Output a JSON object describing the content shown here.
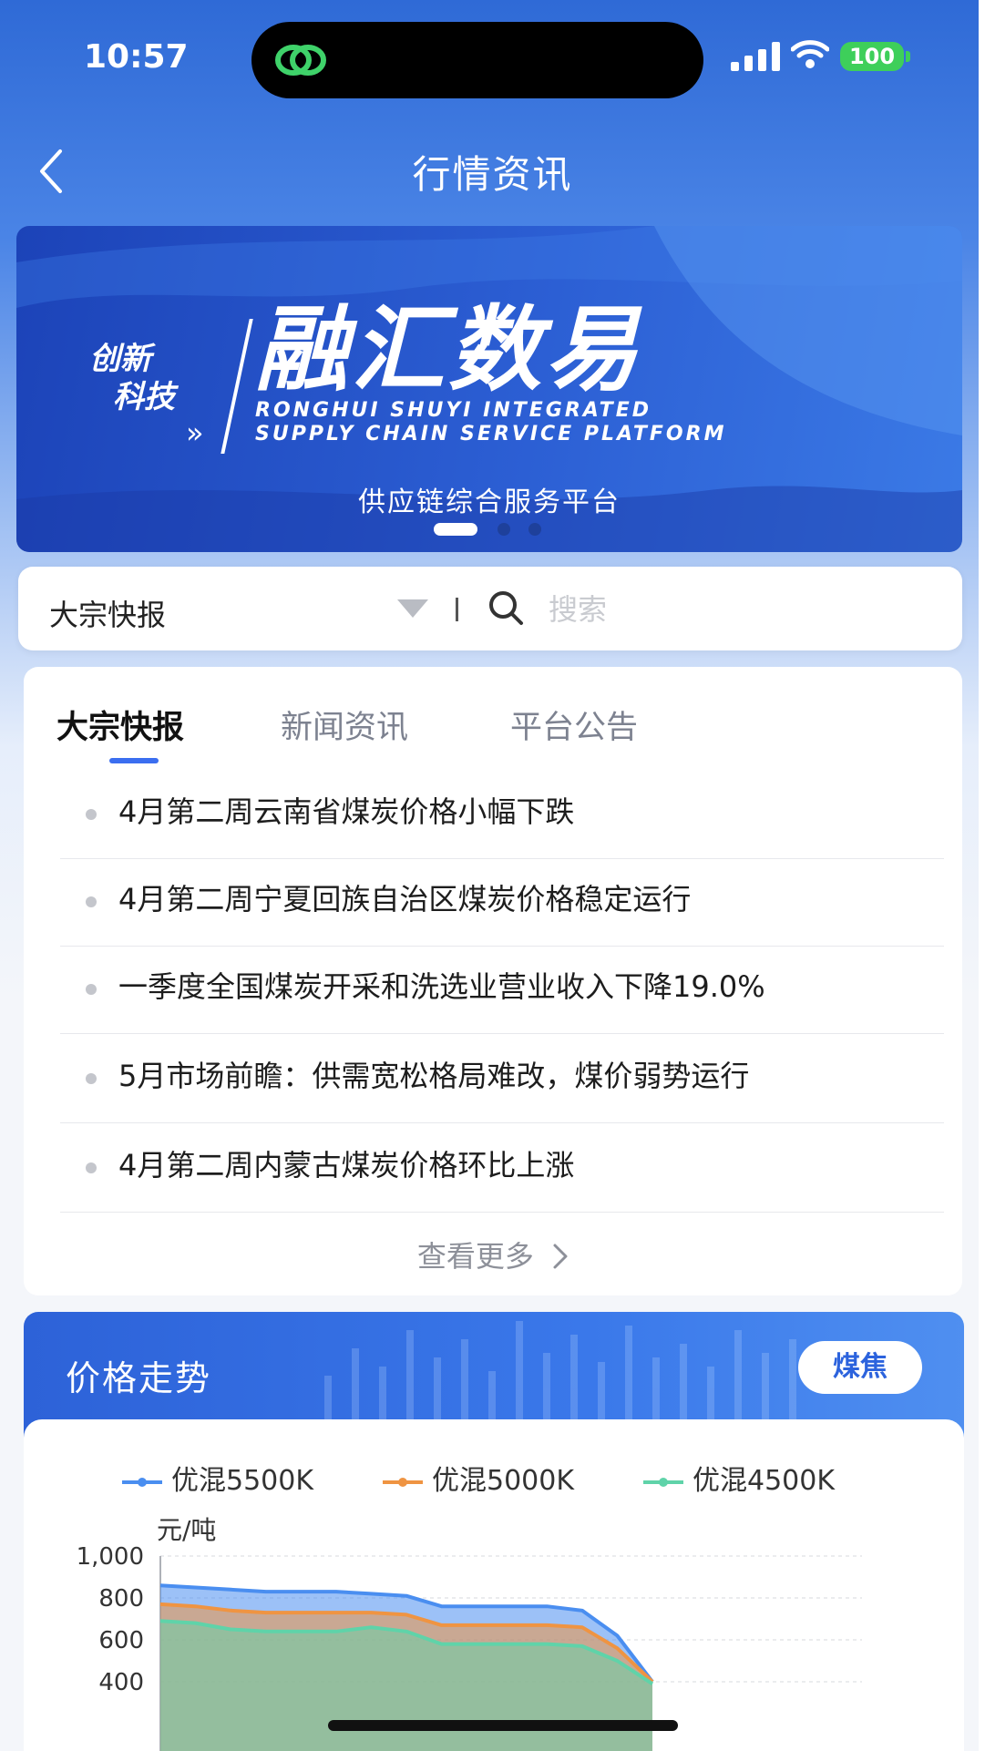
{
  "status_bar": {
    "time": "10:57",
    "battery": "100"
  },
  "header": {
    "title": "行情资讯"
  },
  "banner": {
    "tag_line1": "创新",
    "tag_line2": "科技",
    "tag_arrows": "»",
    "brand": "融汇数易",
    "brand_en_line1": "RONGHUI SHUYI INTEGRATED",
    "brand_en_line2": "SUPPLY CHAIN SERVICE PLATFORM",
    "subtitle": "供应链综合服务平台",
    "active_slide": 1,
    "slide_count": 3
  },
  "search": {
    "category": "大宗快报",
    "separator": "|",
    "placeholder": "搜索"
  },
  "news": {
    "tabs": [
      {
        "label": "大宗快报",
        "active": true
      },
      {
        "label": "新闻资讯",
        "active": false
      },
      {
        "label": "平台公告",
        "active": false
      }
    ],
    "items": [
      "4月第二周云南省煤炭价格小幅下跌",
      "4月第二周宁夏回族自治区煤炭价格稳定运行",
      "一季度全国煤炭开采和洗选业营业收入下降19.0%",
      "5月市场前瞻：供需宽松格局难改，煤价弱势运行",
      "4月第二周内蒙古煤炭价格环比上涨"
    ],
    "more_label": "查看更多"
  },
  "trend": {
    "title": "价格走势",
    "filter_label": "煤焦"
  },
  "colors": {
    "primary": "#2f6ad6",
    "accent_tab": "#3b6ef0",
    "series1": "#4a8ef0",
    "series2": "#ef9442",
    "series3": "#5fd3a9"
  },
  "chart_data": {
    "type": "area",
    "ylabel": "元/吨",
    "yticks": [
      "1,000",
      "800",
      "600",
      "400"
    ],
    "ylim": [
      400,
      1000
    ],
    "grid": true,
    "legend_position": "top",
    "x": [
      0,
      1,
      2,
      3,
      4,
      5,
      6,
      7,
      8,
      9,
      10,
      11,
      12,
      13,
      14
    ],
    "series": [
      {
        "name": "优混5500K",
        "color": "#4a8ef0",
        "values": [
          860,
          850,
          840,
          830,
          830,
          830,
          820,
          810,
          760,
          760,
          760,
          760,
          740,
          620,
          400
        ]
      },
      {
        "name": "优混5000K",
        "color": "#ef9442",
        "values": [
          770,
          760,
          740,
          730,
          730,
          730,
          730,
          720,
          670,
          670,
          670,
          670,
          660,
          560,
          400
        ]
      },
      {
        "name": "优混4500K",
        "color": "#5fd3a9",
        "values": [
          690,
          680,
          650,
          640,
          640,
          640,
          660,
          640,
          580,
          580,
          580,
          580,
          570,
          500,
          390
        ]
      }
    ]
  }
}
